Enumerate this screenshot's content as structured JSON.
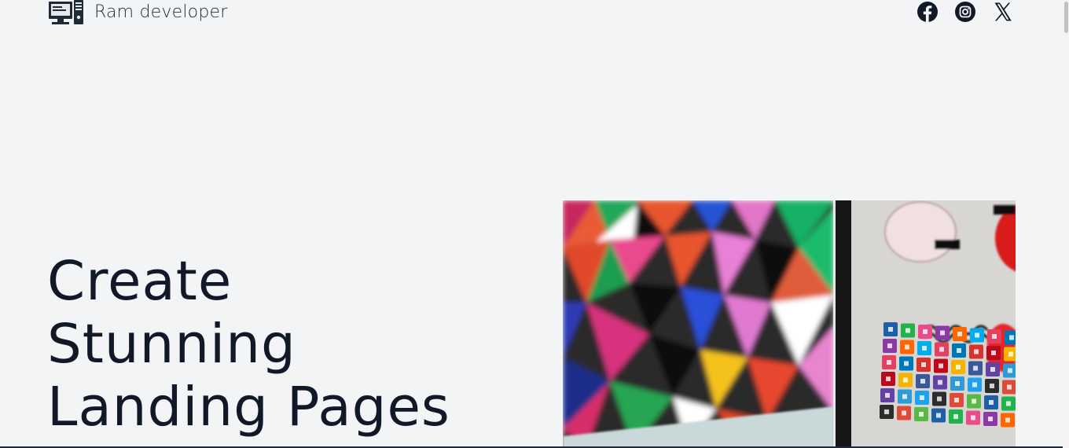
{
  "header": {
    "brand_name": "Ram developer",
    "brand_icon": "computer-desktop-icon"
  },
  "social": [
    {
      "name": "facebook",
      "icon": "facebook-icon"
    },
    {
      "name": "instagram",
      "icon": "instagram-icon"
    },
    {
      "name": "x",
      "icon": "x-icon"
    }
  ],
  "hero": {
    "title_lines": [
      "Create",
      "Stunning",
      "Landing Pages"
    ],
    "image": "hero-image-colorful-screens"
  },
  "colors": {
    "background": "#f3f4f6",
    "text": "#111827"
  }
}
